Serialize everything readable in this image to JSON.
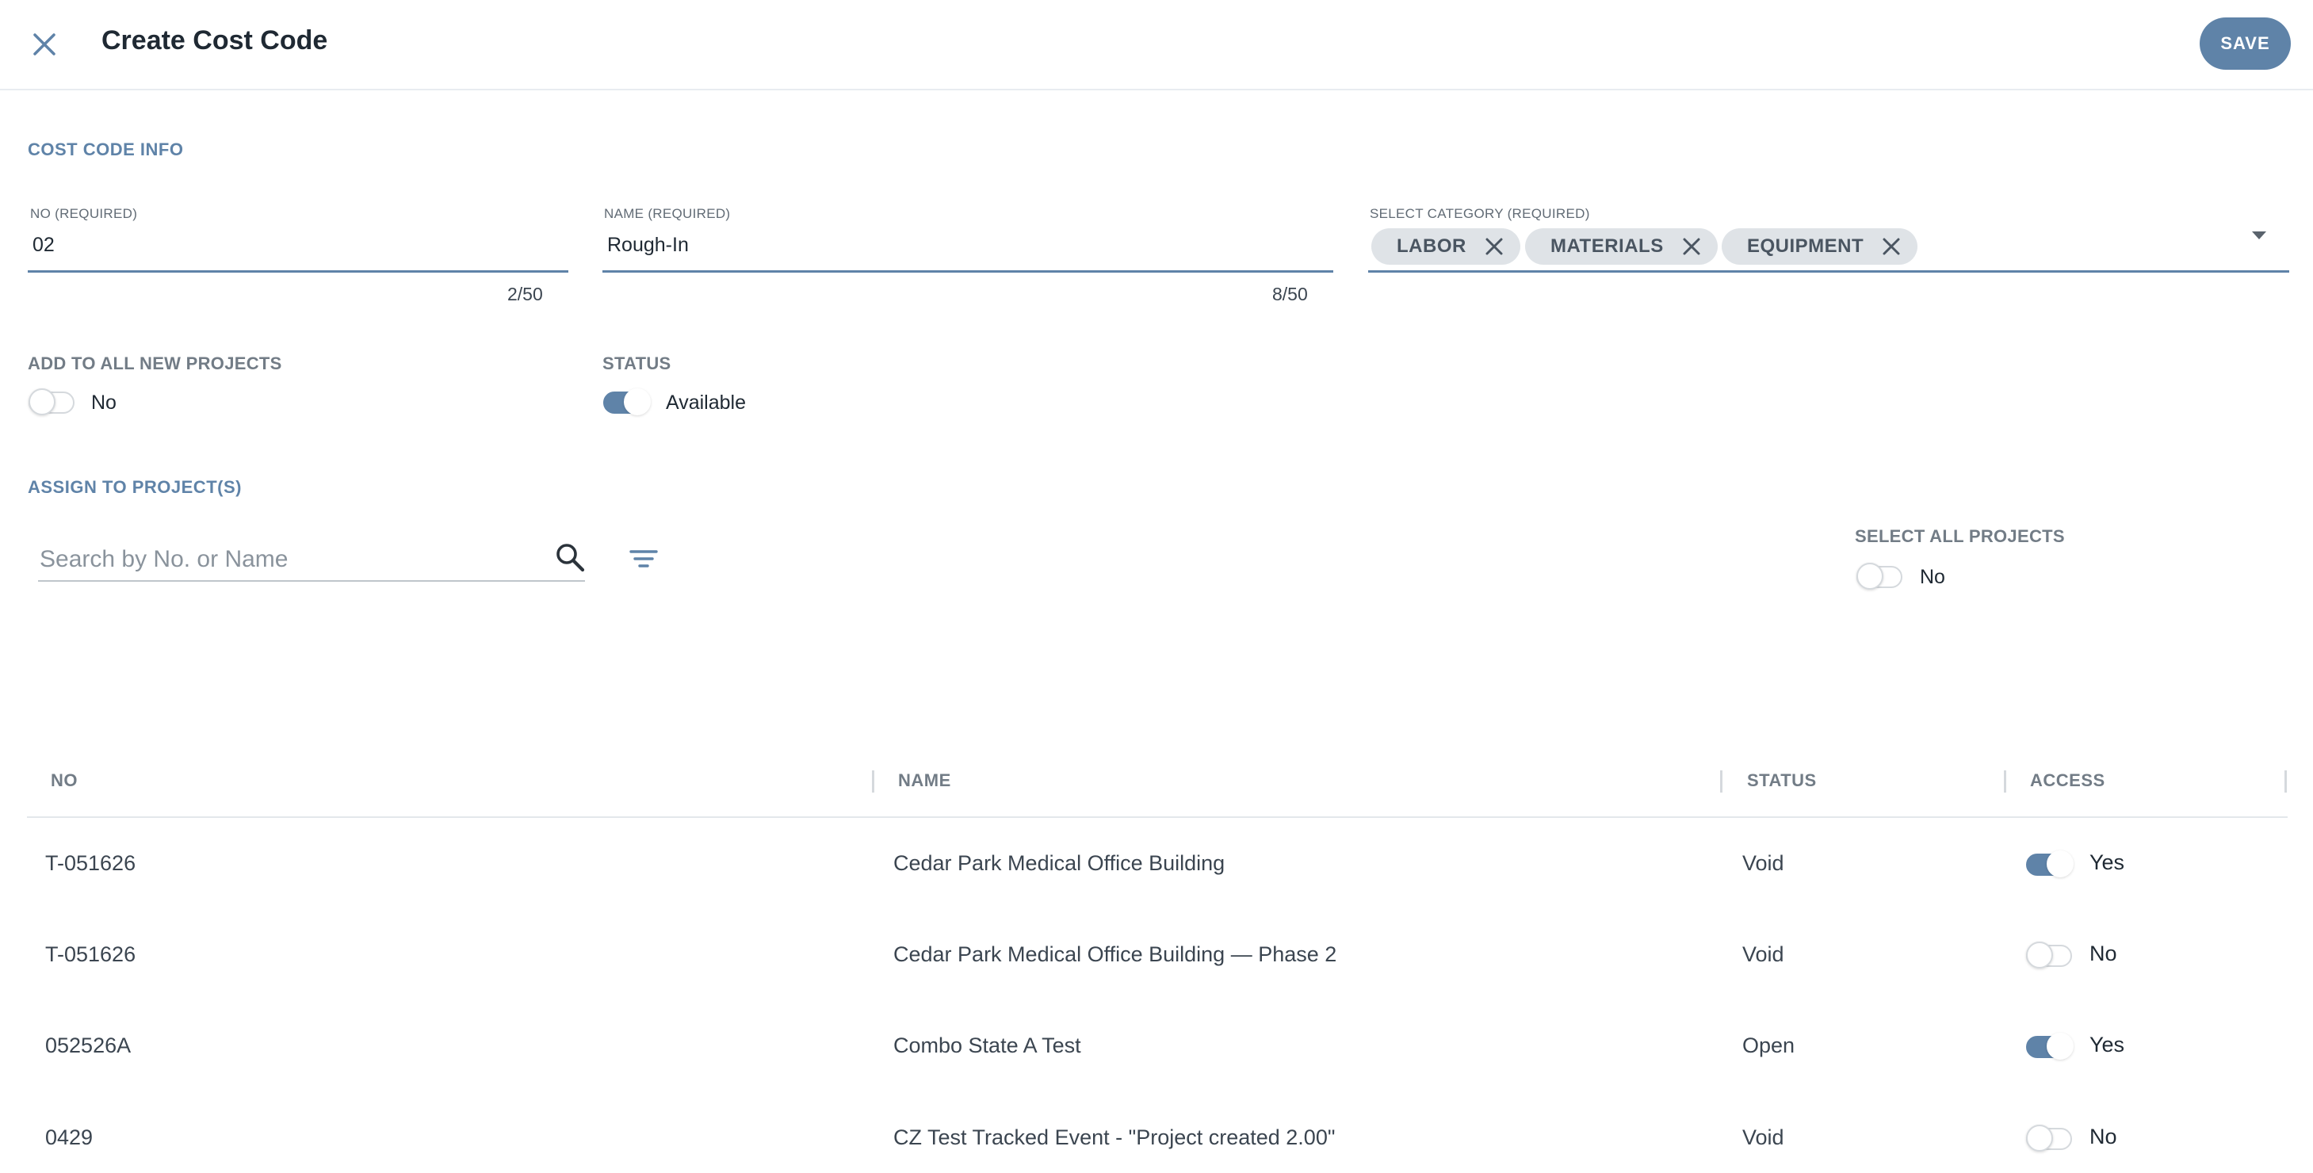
{
  "header": {
    "title": "Create Cost Code",
    "save_label": "SAVE"
  },
  "cost_code_info": {
    "section_title": "COST CODE INFO",
    "no_field": {
      "label": "NO (REQUIRED)",
      "value": "02",
      "counter": "2/50"
    },
    "name_field": {
      "label": "NAME (REQUIRED)",
      "value": "Rough-In",
      "counter": "8/50"
    },
    "category_field": {
      "label": "SELECT CATEGORY (REQUIRED)",
      "chips": [
        "LABOR",
        "MATERIALS",
        "EQUIPMENT"
      ]
    },
    "add_to_all": {
      "label": "ADD TO ALL NEW PROJECTS",
      "value": "No",
      "on": false
    },
    "status": {
      "label": "STATUS",
      "value": "Available",
      "on": true
    }
  },
  "assign": {
    "section_title": "ASSIGN TO PROJECT(S)",
    "search_placeholder": "Search by No. or Name",
    "select_all": {
      "label": "SELECT ALL PROJECTS",
      "value": "No",
      "on": false
    }
  },
  "table": {
    "columns": [
      "NO",
      "NAME",
      "STATUS",
      "ACCESS"
    ],
    "rows": [
      {
        "no": "T-051626",
        "name": "Cedar Park Medical Office Building",
        "status": "Void",
        "access": "Yes",
        "access_on": true
      },
      {
        "no": "T-051626",
        "name": "Cedar Park Medical Office Building — Phase 2",
        "status": "Void",
        "access": "No",
        "access_on": false
      },
      {
        "no": "052526A",
        "name": "Combo State A Test",
        "status": "Open",
        "access": "Yes",
        "access_on": true
      },
      {
        "no": "0429",
        "name": "CZ Test Tracked Event - \"Project created 2.00\"",
        "status": "Void",
        "access": "No",
        "access_on": false
      }
    ]
  },
  "colors": {
    "accent": "#5f83a8",
    "text": "#1f2933",
    "muted": "#727c86"
  },
  "icons": {
    "close": "close-icon",
    "search": "search-icon",
    "filter": "filter-icon",
    "chip_remove": "close-icon",
    "dropdown": "chevron-down-icon"
  }
}
